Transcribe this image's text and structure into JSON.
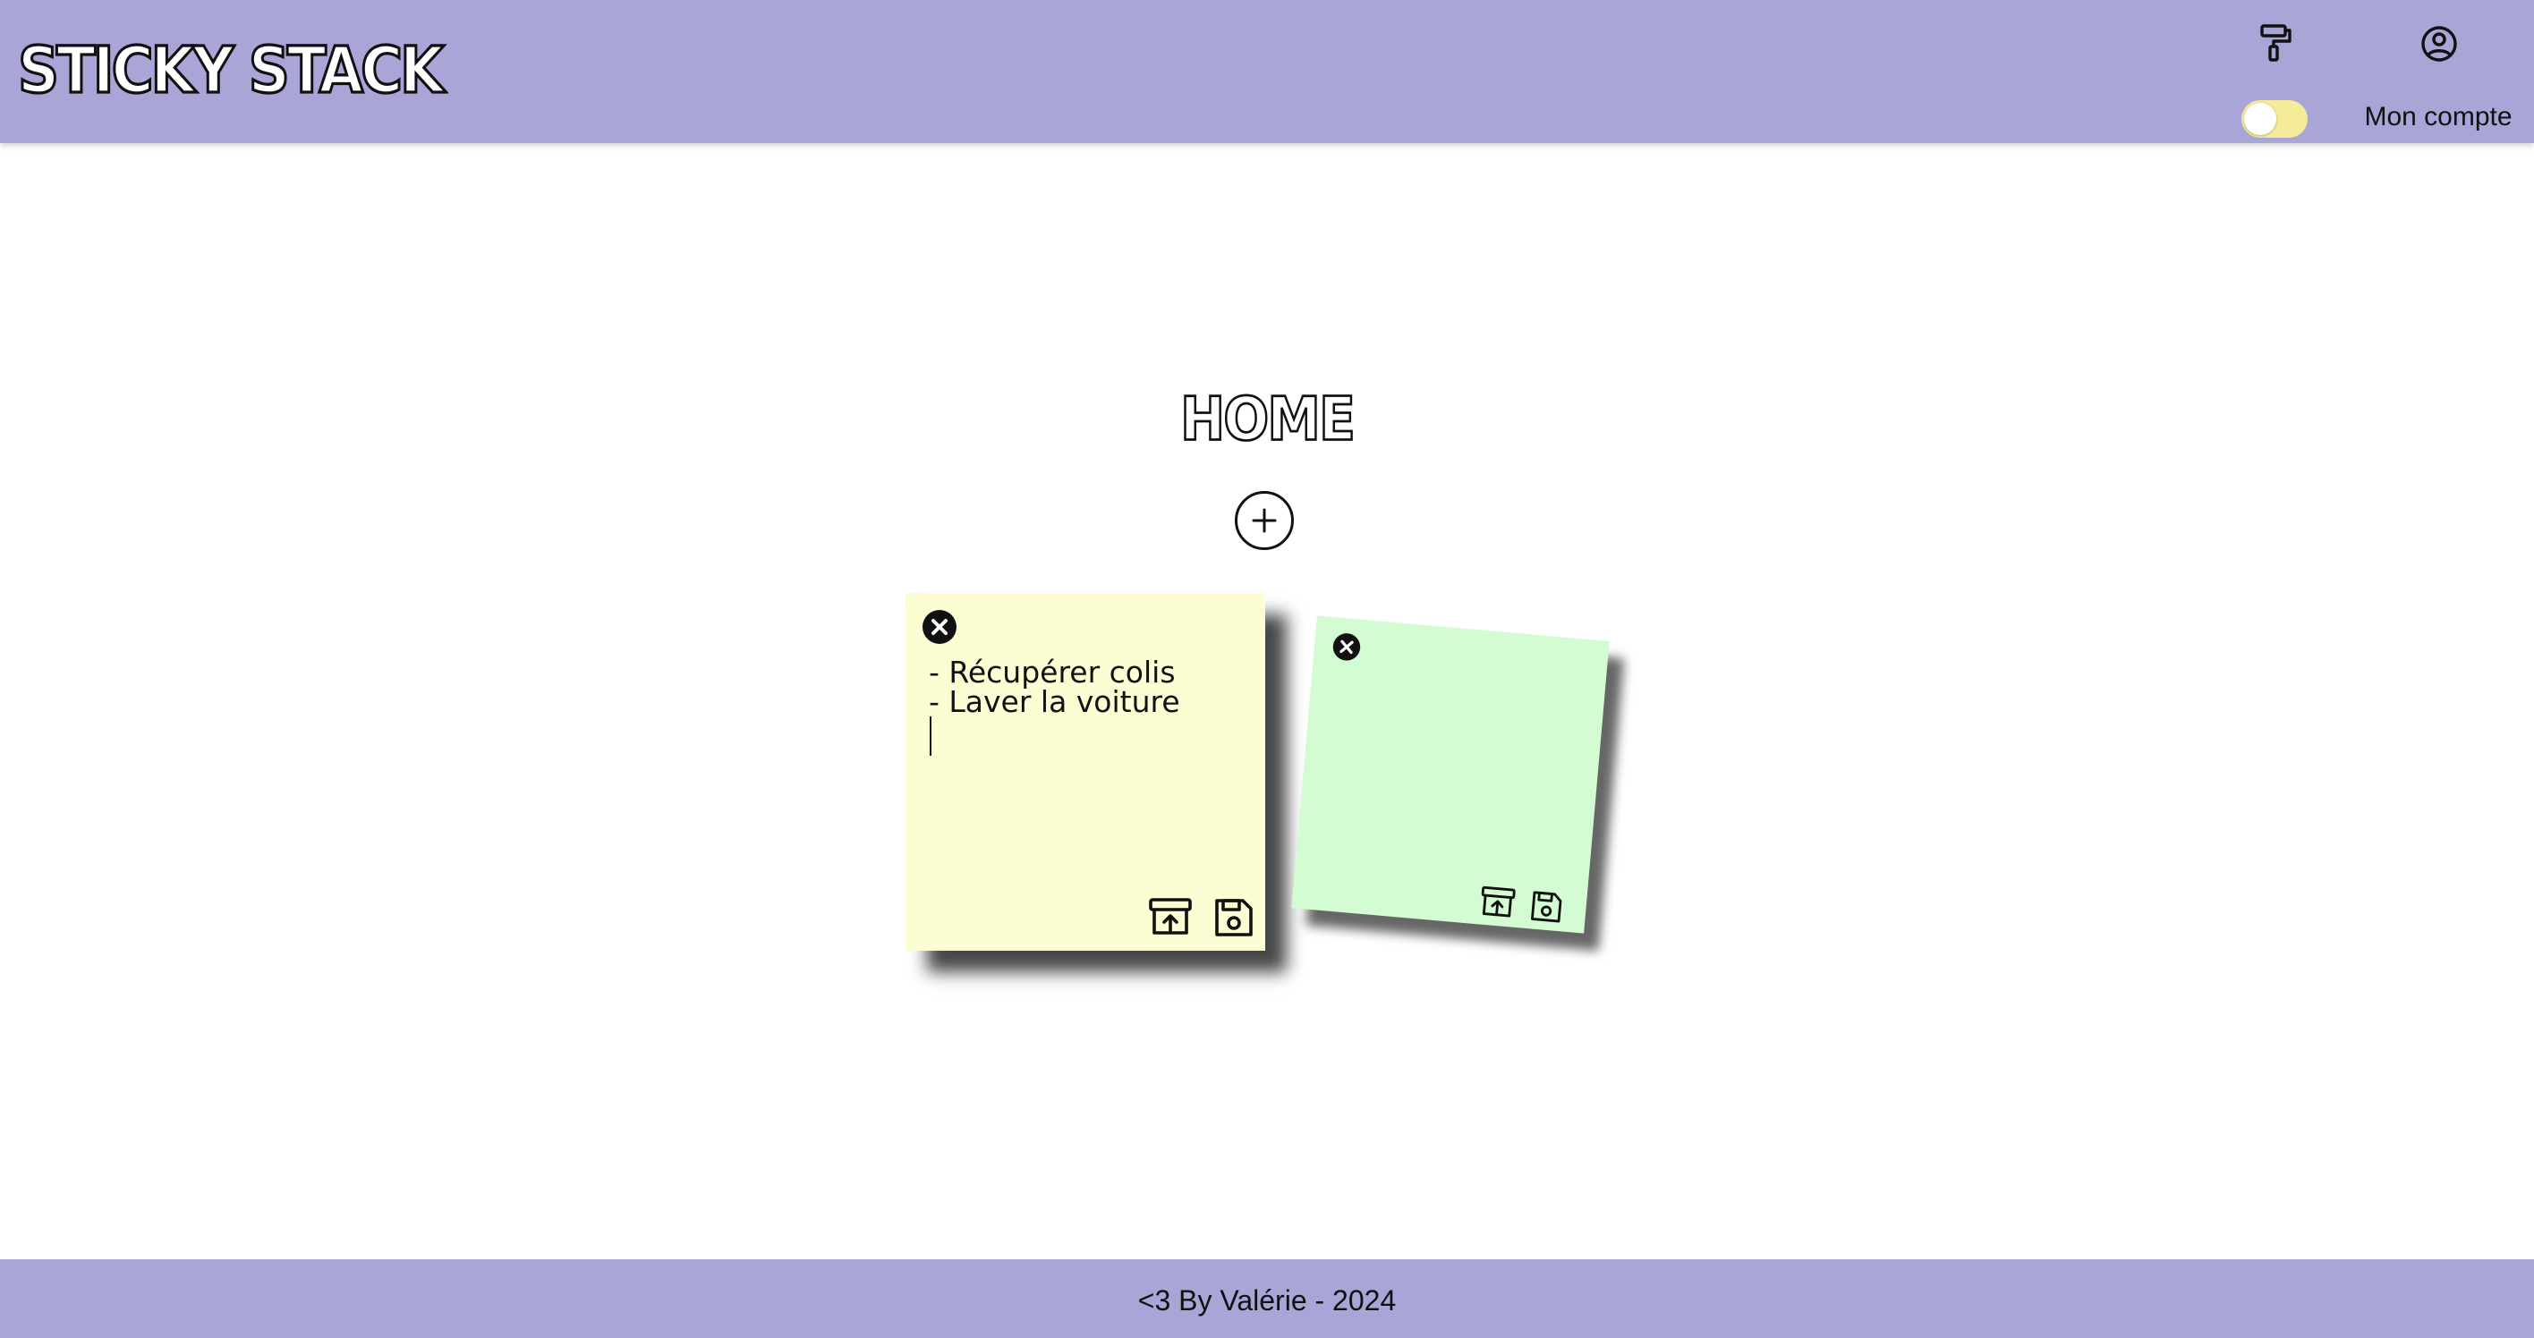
{
  "header": {
    "logo": "STICKY STACK",
    "account_label": "Mon compte",
    "theme_toggle_on": false
  },
  "main": {
    "title": "HOME",
    "notes": [
      {
        "color": "#fdfdd3",
        "text": "- Récupérer colis\n- Laver la voiture"
      },
      {
        "color": "#d3fcd3",
        "text": ""
      }
    ]
  },
  "footer": {
    "text": "<3 By Valérie - 2024"
  },
  "icons": [
    "paint-brush-icon",
    "user-circle-icon",
    "plus-icon",
    "close-circle-icon",
    "archive-upload-icon",
    "floppy-disk-icon"
  ],
  "colors": {
    "header": "#a9a5d7",
    "footer": "#a9a5d7",
    "toggle_track": "#f4ec9b"
  }
}
